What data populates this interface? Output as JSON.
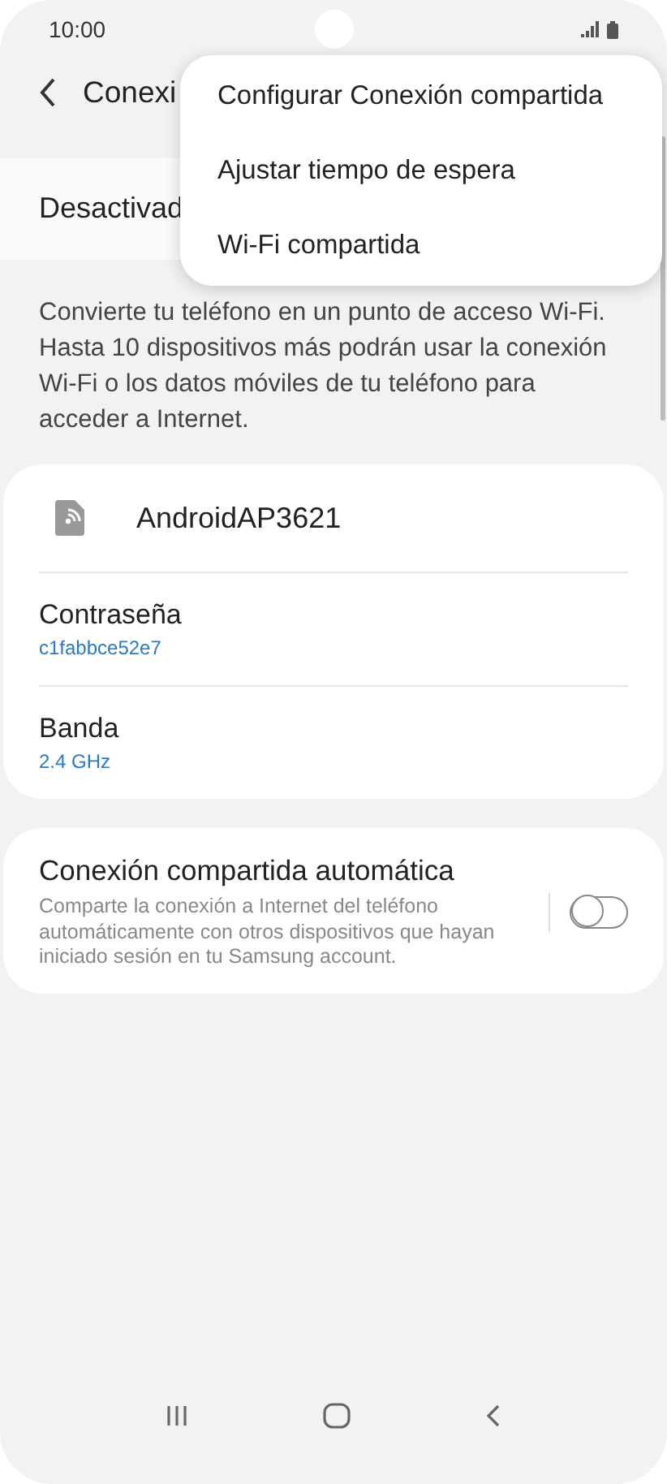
{
  "status_bar": {
    "time": "10:00"
  },
  "header": {
    "title": "Conexi"
  },
  "master_switch": {
    "label": "Desactivad"
  },
  "description": "Convierte tu teléfono en un punto de acceso Wi-Fi. Hasta 10 dispositivos más podrán usar la conexión Wi-Fi o los datos móviles de tu teléfono para acceder a Internet.",
  "network": {
    "name": "AndroidAP3621",
    "fields": [
      {
        "label": "Contraseña",
        "value": "c1fabbce52e7"
      },
      {
        "label": "Banda",
        "value": "2.4 GHz"
      }
    ]
  },
  "auto_share": {
    "title": "Conexión compartida automática",
    "description": "Comparte la conexión a Internet del teléfono automáticamente con otros dispositivos que hayan iniciado sesión en tu Samsung account.",
    "on": false
  },
  "menu": {
    "items": [
      "Configurar Conexión compartida",
      "Ajustar tiempo de espera",
      "Wi-Fi compartida"
    ]
  }
}
